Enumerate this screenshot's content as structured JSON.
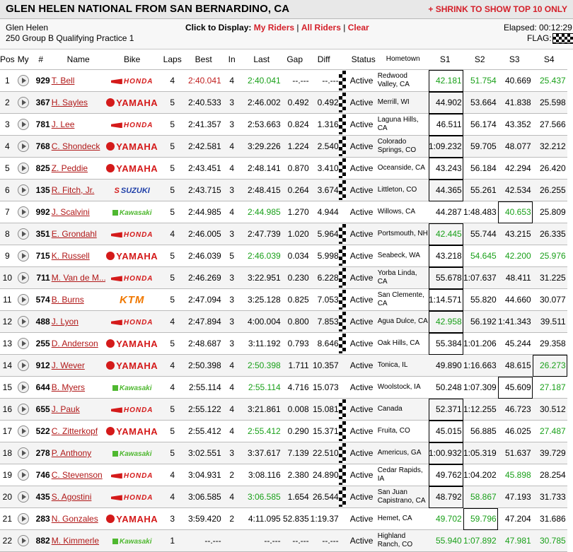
{
  "header": {
    "title": "GLEN HELEN NATIONAL FROM SAN BERNARDINO, CA",
    "shrink_link": "+ SHRINK TO SHOW TOP 10 ONLY"
  },
  "info": {
    "track": "Glen Helen",
    "session": "250 Group B Qualifying Practice 1",
    "display_label": "Click to Display:",
    "my_riders": "My Riders",
    "all_riders": "All Riders",
    "clear": "Clear",
    "sep": "|",
    "elapsed_label": "Elapsed:",
    "elapsed_value": "00:12:29",
    "flag_label": "FLAG:"
  },
  "columns": [
    "Pos",
    "My",
    "#",
    "Name",
    "Bike",
    "Laps",
    "Best",
    "In",
    "Last",
    "Gap",
    "Diff",
    "",
    "Status",
    "Hometown",
    "S1",
    "S2",
    "S3",
    "S4"
  ],
  "colors": {
    "red": "#c02020",
    "green": "#19a019",
    "link": "#d4202a"
  },
  "rows": [
    {
      "pos": "1",
      "num": "929",
      "name": "T. Bell",
      "bike": "HONDA",
      "laps": "4",
      "best": "2:40.041",
      "in": "4",
      "last": "2:40.041",
      "gap": "--.---",
      "diff": "--.---",
      "flag": true,
      "status": "Active",
      "home": "Redwood Valley, CA",
      "s1": "42.181",
      "s2": "51.754",
      "s3": "40.669",
      "s4": "25.437",
      "best_c": "red",
      "last_c": "green",
      "s1_c": "green",
      "s2_c": "green",
      "s3_c": "",
      "s4_c": "green",
      "box": "s1"
    },
    {
      "pos": "2",
      "num": "367",
      "name": "H. Sayles",
      "bike": "YAMAHA",
      "laps": "5",
      "best": "2:40.533",
      "in": "3",
      "last": "2:46.002",
      "gap": "0.492",
      "diff": "0.492",
      "flag": true,
      "status": "Active",
      "home": "Merrill, WI",
      "s1": "44.902",
      "s2": "53.664",
      "s3": "41.838",
      "s4": "25.598",
      "best_c": "",
      "last_c": "",
      "s1_c": "",
      "s2_c": "",
      "s3_c": "",
      "s4_c": "",
      "box": "s1"
    },
    {
      "pos": "3",
      "num": "781",
      "name": "J. Lee",
      "bike": "HONDA",
      "laps": "5",
      "best": "2:41.357",
      "in": "3",
      "last": "2:53.663",
      "gap": "0.824",
      "diff": "1.316",
      "flag": true,
      "status": "Active",
      "home": "Laguna Hills, CA",
      "s1": "46.511",
      "s2": "56.174",
      "s3": "43.352",
      "s4": "27.566",
      "best_c": "",
      "last_c": "",
      "s1_c": "",
      "s2_c": "",
      "s3_c": "",
      "s4_c": "",
      "box": "s1"
    },
    {
      "pos": "4",
      "num": "768",
      "name": "C. Shondeck",
      "bike": "YAMAHA",
      "laps": "5",
      "best": "2:42.581",
      "in": "4",
      "last": "3:29.226",
      "gap": "1.224",
      "diff": "2.540",
      "flag": true,
      "status": "Active",
      "home": "Colorado Springs, CO",
      "s1": "1:09.232",
      "s2": "59.705",
      "s3": "48.077",
      "s4": "32.212",
      "best_c": "",
      "last_c": "",
      "s1_c": "",
      "s2_c": "",
      "s3_c": "",
      "s4_c": "",
      "box": "s1"
    },
    {
      "pos": "5",
      "num": "825",
      "name": "Z. Peddie",
      "bike": "YAMAHA",
      "laps": "5",
      "best": "2:43.451",
      "in": "4",
      "last": "2:48.141",
      "gap": "0.870",
      "diff": "3.410",
      "flag": true,
      "status": "Active",
      "home": "Oceanside, CA",
      "s1": "43.243",
      "s2": "56.184",
      "s3": "42.294",
      "s4": "26.420",
      "best_c": "",
      "last_c": "",
      "s1_c": "",
      "s2_c": "",
      "s3_c": "",
      "s4_c": "",
      "box": "s1"
    },
    {
      "pos": "6",
      "num": "135",
      "name": "R. Fitch, Jr.",
      "bike": "SUZUKI",
      "laps": "5",
      "best": "2:43.715",
      "in": "3",
      "last": "2:48.415",
      "gap": "0.264",
      "diff": "3.674",
      "flag": true,
      "status": "Active",
      "home": "Littleton, CO",
      "s1": "44.365",
      "s2": "55.261",
      "s3": "42.534",
      "s4": "26.255",
      "best_c": "",
      "last_c": "",
      "s1_c": "",
      "s2_c": "",
      "s3_c": "",
      "s4_c": "",
      "box": "s1"
    },
    {
      "pos": "7",
      "num": "992",
      "name": "J. Scalvini",
      "bike": "Kawasaki",
      "laps": "5",
      "best": "2:44.985",
      "in": "4",
      "last": "2:44.985",
      "gap": "1.270",
      "diff": "4.944",
      "flag": false,
      "status": "Active",
      "home": "Willows, CA",
      "s1": "44.287",
      "s2": "1:48.483",
      "s3": "40.653",
      "s4": "25.809",
      "best_c": "",
      "last_c": "green",
      "s1_c": "",
      "s2_c": "",
      "s3_c": "green",
      "s4_c": "",
      "box": "s3"
    },
    {
      "pos": "8",
      "num": "351",
      "name": "E. Grondahl",
      "bike": "HONDA",
      "laps": "4",
      "best": "2:46.005",
      "in": "3",
      "last": "2:47.739",
      "gap": "1.020",
      "diff": "5.964",
      "flag": true,
      "status": "Active",
      "home": "Portsmouth, NH",
      "s1": "42.445",
      "s2": "55.744",
      "s3": "43.215",
      "s4": "26.335",
      "best_c": "",
      "last_c": "",
      "s1_c": "green",
      "s2_c": "",
      "s3_c": "",
      "s4_c": "",
      "box": "s1"
    },
    {
      "pos": "9",
      "num": "715",
      "name": "K. Russell",
      "bike": "YAMAHA",
      "laps": "5",
      "best": "2:46.039",
      "in": "5",
      "last": "2:46.039",
      "gap": "0.034",
      "diff": "5.998",
      "flag": true,
      "status": "Active",
      "home": "Seabeck, WA",
      "s1": "43.218",
      "s2": "54.645",
      "s3": "42.200",
      "s4": "25.976",
      "best_c": "",
      "last_c": "green",
      "s1_c": "",
      "s2_c": "green",
      "s3_c": "green",
      "s4_c": "green",
      "box": "s1"
    },
    {
      "pos": "10",
      "num": "711",
      "name": "M. Van de M...",
      "bike": "HONDA",
      "laps": "5",
      "best": "2:46.269",
      "in": "3",
      "last": "3:22.951",
      "gap": "0.230",
      "diff": "6.228",
      "flag": true,
      "status": "Active",
      "home": "Yorba Linda, CA",
      "s1": "55.678",
      "s2": "1:07.637",
      "s3": "48.411",
      "s4": "31.225",
      "best_c": "",
      "last_c": "",
      "s1_c": "",
      "s2_c": "",
      "s3_c": "",
      "s4_c": "",
      "box": "s1"
    },
    {
      "pos": "11",
      "num": "574",
      "name": "B. Burns",
      "bike": "KTM",
      "laps": "5",
      "best": "2:47.094",
      "in": "3",
      "last": "3:25.128",
      "gap": "0.825",
      "diff": "7.053",
      "flag": true,
      "status": "Active",
      "home": "San Clemente, CA",
      "s1": "1:14.571",
      "s2": "55.820",
      "s3": "44.660",
      "s4": "30.077",
      "best_c": "",
      "last_c": "",
      "s1_c": "",
      "s2_c": "",
      "s3_c": "",
      "s4_c": "",
      "box": "s1"
    },
    {
      "pos": "12",
      "num": "488",
      "name": "J. Lyon",
      "bike": "HONDA",
      "laps": "4",
      "best": "2:47.894",
      "in": "3",
      "last": "4:00.004",
      "gap": "0.800",
      "diff": "7.853",
      "flag": true,
      "status": "Active",
      "home": "Agua Dulce, CA",
      "s1": "42.958",
      "s2": "56.192",
      "s3": "1:41.343",
      "s4": "39.511",
      "best_c": "",
      "last_c": "",
      "s1_c": "green",
      "s2_c": "",
      "s3_c": "",
      "s4_c": "",
      "box": "s1"
    },
    {
      "pos": "13",
      "num": "255",
      "name": "D. Anderson",
      "bike": "YAMAHA",
      "laps": "5",
      "best": "2:48.687",
      "in": "3",
      "last": "3:11.192",
      "gap": "0.793",
      "diff": "8.646",
      "flag": true,
      "status": "Active",
      "home": "Oak Hills, CA",
      "s1": "55.384",
      "s2": "1:01.206",
      "s3": "45.244",
      "s4": "29.358",
      "best_c": "",
      "last_c": "",
      "s1_c": "",
      "s2_c": "",
      "s3_c": "",
      "s4_c": "",
      "box": "s1"
    },
    {
      "pos": "14",
      "num": "912",
      "name": "J. Wever",
      "bike": "YAMAHA",
      "laps": "4",
      "best": "2:50.398",
      "in": "4",
      "last": "2:50.398",
      "gap": "1.711",
      "diff": "10.357",
      "flag": false,
      "status": "Active",
      "home": "Tonica, IL",
      "s1": "49.890",
      "s2": "1:16.663",
      "s3": "48.615",
      "s4": "26.273",
      "best_c": "",
      "last_c": "green",
      "s1_c": "",
      "s2_c": "",
      "s3_c": "",
      "s4_c": "green",
      "box": "s4"
    },
    {
      "pos": "15",
      "num": "644",
      "name": "B. Myers",
      "bike": "Kawasaki",
      "laps": "4",
      "best": "2:55.114",
      "in": "4",
      "last": "2:55.114",
      "gap": "4.716",
      "diff": "15.073",
      "flag": false,
      "status": "Active",
      "home": "Woolstock, IA",
      "s1": "50.248",
      "s2": "1:07.309",
      "s3": "45.609",
      "s4": "27.187",
      "best_c": "",
      "last_c": "green",
      "s1_c": "",
      "s2_c": "",
      "s3_c": "",
      "s4_c": "green",
      "box": "s3"
    },
    {
      "pos": "16",
      "num": "655",
      "name": "J. Pauk",
      "bike": "HONDA",
      "laps": "5",
      "best": "2:55.122",
      "in": "4",
      "last": "3:21.861",
      "gap": "0.008",
      "diff": "15.081",
      "flag": true,
      "status": "Active",
      "home": "Canada",
      "s1": "52.371",
      "s2": "1:12.255",
      "s3": "46.723",
      "s4": "30.512",
      "best_c": "",
      "last_c": "",
      "s1_c": "",
      "s2_c": "",
      "s3_c": "",
      "s4_c": "",
      "box": "s1"
    },
    {
      "pos": "17",
      "num": "522",
      "name": "C. Zitterkopf",
      "bike": "YAMAHA",
      "laps": "5",
      "best": "2:55.412",
      "in": "4",
      "last": "2:55.412",
      "gap": "0.290",
      "diff": "15.371",
      "flag": true,
      "status": "Active",
      "home": "Fruita, CO",
      "s1": "45.015",
      "s2": "56.885",
      "s3": "46.025",
      "s4": "27.487",
      "best_c": "",
      "last_c": "green",
      "s1_c": "",
      "s2_c": "",
      "s3_c": "",
      "s4_c": "green",
      "box": "s1"
    },
    {
      "pos": "18",
      "num": "278",
      "name": "P. Anthony",
      "bike": "Kawasaki",
      "laps": "5",
      "best": "3:02.551",
      "in": "3",
      "last": "3:37.617",
      "gap": "7.139",
      "diff": "22.510",
      "flag": true,
      "status": "Active",
      "home": "Americus, GA",
      "s1": "1:00.932",
      "s2": "1:05.319",
      "s3": "51.637",
      "s4": "39.729",
      "best_c": "",
      "last_c": "",
      "s1_c": "",
      "s2_c": "",
      "s3_c": "",
      "s4_c": "",
      "box": "s1"
    },
    {
      "pos": "19",
      "num": "746",
      "name": "C. Stevenson",
      "bike": "HONDA",
      "laps": "4",
      "best": "3:04.931",
      "in": "2",
      "last": "3:08.116",
      "gap": "2.380",
      "diff": "24.890",
      "flag": true,
      "status": "Active",
      "home": "Cedar Rapids, IA",
      "s1": "49.762",
      "s2": "1:04.202",
      "s3": "45.898",
      "s4": "28.254",
      "best_c": "",
      "last_c": "",
      "s1_c": "",
      "s2_c": "",
      "s3_c": "green",
      "s4_c": "",
      "box": "s1"
    },
    {
      "pos": "20",
      "num": "435",
      "name": "S. Agostini",
      "bike": "HONDA",
      "laps": "4",
      "best": "3:06.585",
      "in": "4",
      "last": "3:06.585",
      "gap": "1.654",
      "diff": "26.544",
      "flag": true,
      "status": "Active",
      "home": "San Juan Capistrano, CA",
      "s1": "48.792",
      "s2": "58.867",
      "s3": "47.193",
      "s4": "31.733",
      "best_c": "",
      "last_c": "green",
      "s1_c": "",
      "s2_c": "green",
      "s3_c": "",
      "s4_c": "",
      "box": "s1"
    },
    {
      "pos": "21",
      "num": "283",
      "name": "N. Gonzales",
      "bike": "YAMAHA",
      "laps": "3",
      "best": "3:59.420",
      "in": "2",
      "last": "4:11.095",
      "gap": "52.835",
      "diff": "1:19.37",
      "flag": false,
      "status": "Active",
      "home": "Hemet, CA",
      "s1": "49.702",
      "s2": "59.796",
      "s3": "47.204",
      "s4": "31.686",
      "best_c": "",
      "last_c": "",
      "s1_c": "green",
      "s2_c": "green",
      "s3_c": "",
      "s4_c": "",
      "box": "s2"
    },
    {
      "pos": "22",
      "num": "882",
      "name": "M. Kimmerle",
      "bike": "Kawasaki",
      "laps": "1",
      "best": "--.---",
      "in": "",
      "last": "--.---",
      "gap": "--.---",
      "diff": "--.---",
      "flag": false,
      "status": "Active",
      "home": "Highland Ranch, CO",
      "s1": "55.940",
      "s2": "1:07.892",
      "s3": "47.981",
      "s4": "30.785",
      "best_c": "",
      "last_c": "",
      "s1_c": "green",
      "s2_c": "green",
      "s3_c": "green",
      "s4_c": "green",
      "box": ""
    }
  ]
}
